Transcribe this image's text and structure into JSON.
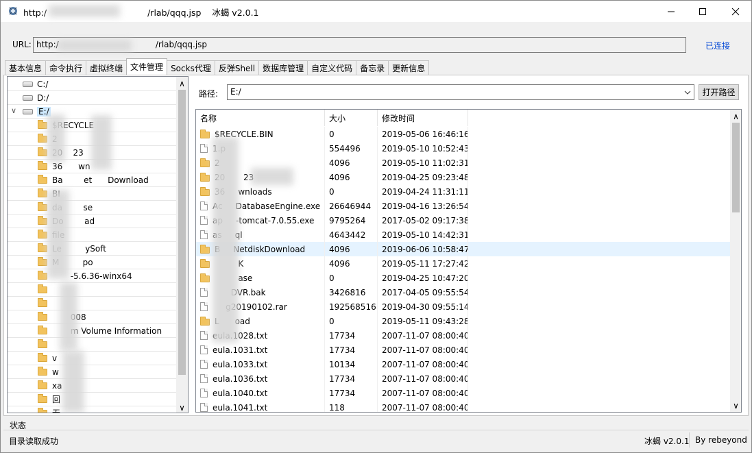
{
  "window": {
    "title": "http:/                                     /rlab/qqq.jsp    冰蝎 v2.0.1",
    "minimize_glyph": "—",
    "maximize_glyph": "☐",
    "close_glyph": "✕"
  },
  "url_bar": {
    "label": "URL:",
    "value": "http:/                                     /rlab/qqq.jsp",
    "status": "已连接"
  },
  "tabs": [
    {
      "label": "基本信息"
    },
    {
      "label": "命令执行"
    },
    {
      "label": "虚拟终端"
    },
    {
      "label": "文件管理"
    },
    {
      "label": "Socks代理"
    },
    {
      "label": "反弹Shell"
    },
    {
      "label": "数据库管理"
    },
    {
      "label": "自定义代码"
    },
    {
      "label": "备忘录"
    },
    {
      "label": "更新信息"
    }
  ],
  "active_tab": "文件管理",
  "tree": {
    "drives": [
      {
        "label": "C:/",
        "expanded": false
      },
      {
        "label": "D:/",
        "expanded": false
      },
      {
        "label": "E:/",
        "expanded": true,
        "toggle_glyph": "∨"
      }
    ],
    "folders": [
      "$RECYCLE",
      "2",
      "20    23",
      "36      wn",
      "Ba        et      Download",
      "BI",
      "da        se",
      "Do        ad",
      "file",
      "Le         ySoft",
      "M         po",
      "       -5.6.36-winx64",
      "",
      "",
      "       008",
      "       m Volume Information",
      "",
      "v",
      "w",
      "xa",
      "回",
      "无"
    ]
  },
  "path_bar": {
    "label": "路径:",
    "value": "E:/",
    "open_button": "打开路径"
  },
  "file_table": {
    "columns": [
      "名称",
      "大小",
      "修改时间"
    ],
    "highlighted_row": 8,
    "rows": [
      {
        "type": "folder",
        "name": "$RECYCLE.BIN",
        "size": "0",
        "time": "2019-05-06 16:46:16"
      },
      {
        "type": "file",
        "name": "1.p",
        "size": "554496",
        "time": "2019-05-10 10:52:43"
      },
      {
        "type": "folder",
        "name": "2",
        "size": "4096",
        "time": "2019-05-10 11:02:31"
      },
      {
        "type": "folder",
        "name": "20       23",
        "size": "4096",
        "time": "2019-04-25 09:23:48"
      },
      {
        "type": "folder",
        "name": "36     wnloads",
        "size": "0",
        "time": "2019-04-24 11:31:11"
      },
      {
        "type": "file",
        "name": "Ac     DatabaseEngine.exe",
        "size": "26646944",
        "time": "2019-04-16 13:26:54"
      },
      {
        "type": "file",
        "name": "ap     -tomcat-7.0.55.exe",
        "size": "9795264",
        "time": "2017-05-02 09:17:38"
      },
      {
        "type": "file",
        "name": "as     ql",
        "size": "4643442",
        "time": "2019-05-10 14:42:31"
      },
      {
        "type": "folder",
        "name": "B     NetdiskDownload",
        "size": "4096",
        "time": "2019-06-06 10:58:47"
      },
      {
        "type": "folder",
        "name": "         K",
        "size": "4096",
        "time": "2019-05-11 17:27:42"
      },
      {
        "type": "folder",
        "name": "         ase",
        "size": "0",
        "time": "2019-04-25 10:47:20"
      },
      {
        "type": "file",
        "name": "       DVR.bak",
        "size": "3426816",
        "time": "2017-04-05 09:55:54"
      },
      {
        "type": "file",
        "name": "     g20190102.rar",
        "size": "192568516",
        "time": "2019-04-30 09:55:14"
      },
      {
        "type": "folder",
        "name": "L      oad",
        "size": "0",
        "time": "2019-05-11 09:43:28"
      },
      {
        "type": "file",
        "name": "eula.1028.txt",
        "size": "17734",
        "time": "2007-11-07 08:00:40"
      },
      {
        "type": "file",
        "name": "eula.1031.txt",
        "size": "17734",
        "time": "2007-11-07 08:00:40"
      },
      {
        "type": "file",
        "name": "eula.1033.txt",
        "size": "10134",
        "time": "2007-11-07 08:00:40"
      },
      {
        "type": "file",
        "name": "eula.1036.txt",
        "size": "17734",
        "time": "2007-11-07 08:00:40"
      },
      {
        "type": "file",
        "name": "eula.1040.txt",
        "size": "17734",
        "time": "2007-11-07 08:00:40"
      },
      {
        "type": "file",
        "name": "eula.1041.txt",
        "size": "118",
        "time": "2007-11-07 08:00:40"
      }
    ]
  },
  "scroll": {
    "up_glyph": "∧",
    "down_glyph": "∨"
  },
  "status_bar": {
    "label": "状态",
    "message": "目录读取成功",
    "version": "冰蝎 v2.0.1",
    "author": "By rebeyond"
  },
  "colors": {
    "accent_link": "#0046d5",
    "row_highlight": "#e5f3ff",
    "folder": "#f2c35e"
  }
}
